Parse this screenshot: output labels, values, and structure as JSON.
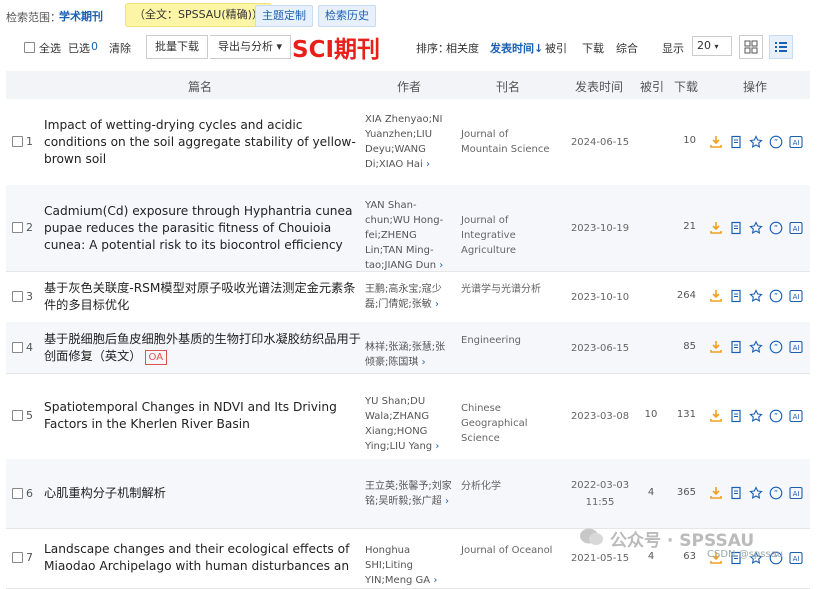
{
  "search_scope": {
    "label": "检索范围：",
    "value": "学术期刊",
    "fulltext_query": "（全文：SPSSAU(精确)）",
    "topic_button": "主题定制",
    "history_button": "检索历史"
  },
  "toolbar": {
    "select_all": "全选",
    "selected": "已选",
    "selected_count": "0",
    "clear": "清除",
    "batch_download": "批量下载",
    "export_analyze": "导出与分析 ▾",
    "overlay_title": "SCI期刊",
    "sort_label": "排序：",
    "sort_options": [
      "相关度",
      "发表时间↓",
      "被引",
      "下载",
      "综合"
    ],
    "display_label": "显示",
    "display_value": "20"
  },
  "table": {
    "headers": [
      "篇名",
      "作者",
      "刊名",
      "发表时间",
      "被引",
      "下载",
      "操作"
    ],
    "rows": [
      {
        "num": "1",
        "title": "Impact of wetting-drying cycles and acidic conditions on the soil aggregate stability of yellow-brown soil",
        "authors": "XIA Zhenyao;NI Yuanzhen;LIU Deyu;WANG Di;XIAO Hai",
        "journal": "Journal of Mountain Science",
        "date": "2024-06-15",
        "cited": "",
        "downloads": "10",
        "oa": ""
      },
      {
        "num": "2",
        "title": "Cadmium(Cd) exposure through Hyphantria cunea pupae reduces the parasitic fitness of Chouioia cunea: A potential risk to its biocontrol efficiency",
        "authors": "YAN Shan-chun;WU Hong-fei;ZHENG Lin;TAN Ming-tao;JIANG Dun",
        "journal": "Journal of Integrative Agriculture",
        "date": "2023-10-19",
        "cited": "",
        "downloads": "21",
        "oa": ""
      },
      {
        "num": "3",
        "title": "基于灰色关联度-RSM模型对原子吸收光谱法测定金元素条件的多目标优化",
        "authors": "王鹏;高永宝;寇少磊;门倩妮;张敏",
        "journal": "光谱学与光谱分析",
        "date": "2023-10-10",
        "cited": "",
        "downloads": "264",
        "oa": ""
      },
      {
        "num": "4",
        "title": "基于脱细胞后鱼皮细胞外基质的生物打印水凝胶纺织品用于创面修复（英文）",
        "authors": "林祥;张涵;张慧;张倾豪;陈国琪",
        "journal": "Engineering",
        "date": "2023-06-15",
        "cited": "",
        "downloads": "85",
        "oa": "OA"
      },
      {
        "num": "5",
        "title": "Spatiotemporal Changes in NDVI and Its Driving Factors in the Kherlen River Basin",
        "authors": "YU Shan;DU Wala;ZHANG Xiang;HONG Ying;LIU Yang",
        "journal": "Chinese Geographical Science",
        "date": "2023-03-08",
        "cited": "10",
        "downloads": "131",
        "oa": ""
      },
      {
        "num": "6",
        "title": "心肌重构分子机制解析",
        "authors": "王立英;张馨予;刘家铭;吴昕毅;张广超",
        "journal": "分析化学",
        "date": "2022-03-03 11:55",
        "cited": "4",
        "downloads": "365",
        "oa": ""
      },
      {
        "num": "7",
        "title": "Landscape changes and their ecological effects of Miaodao Archipelago with human disturbances an",
        "authors": "Honghua SHI;Liting YIN;Meng GA",
        "journal": "Journal of Oceanol",
        "date": "2021-05-15",
        "cited": "4",
        "downloads": "63",
        "oa": ""
      }
    ]
  },
  "icons": [
    "download-icon",
    "read-icon",
    "favorite-icon",
    "cite-icon",
    "ai-icon"
  ],
  "colors": {
    "accent": "#1a5fb4",
    "highlight": "#fdf5a6",
    "overlay_red": "#e8201a",
    "icon_orange": "#f0a020"
  },
  "watermark": {
    "text": "公众号 · SPSSAU",
    "csdn": "CSDN @spssau"
  }
}
